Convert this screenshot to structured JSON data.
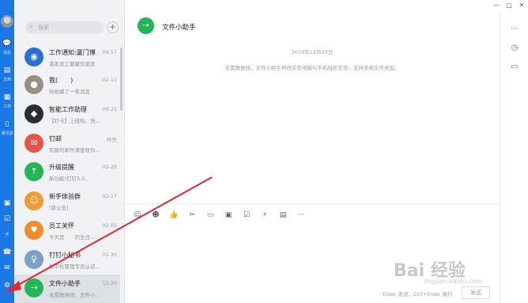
{
  "rail": {
    "labels": [
      "消息",
      "文档",
      "工作",
      "通讯录"
    ]
  },
  "search": {
    "placeholder": "搜索",
    "add": "+"
  },
  "conversations": [
    {
      "title": "工作通知:厦门博...",
      "time": "09:57",
      "preview": "诸发员工健康信息管",
      "color": "#2a6fd6",
      "icon": "◉"
    },
    {
      "title": "我(　　)",
      "time": "02-11",
      "preview": "你收藏了一条消息",
      "color": "#9a8f86",
      "icon": "●"
    },
    {
      "title": "智能工作助理",
      "time": "09:21",
      "preview": "【打卡】上班啦，快...",
      "color": "#2a2d33",
      "icon": "◆"
    },
    {
      "title": "钉邮",
      "time": "昨天",
      "preview": "有新的邮件请查收你...",
      "color": "#e8524a",
      "icon": "✉"
    },
    {
      "title": "升级提醒",
      "time": "02-26",
      "preview": "新功能!钉钉5.0...",
      "color": "#24b45a",
      "icon": "↑"
    },
    {
      "title": "新手体验群",
      "time": "02-17",
      "preview": "[新公告]",
      "color": "#f19a38",
      "icon": "☺"
    },
    {
      "title": "员工关怀",
      "time": "02-05",
      "preview": "今天是　　的生日...",
      "color": "#f28b2c",
      "icon": "♥"
    },
    {
      "title": "钉钉小秘书",
      "time": "01-30",
      "preview": "数字化管理专员认证...",
      "color": "#7aa0c8",
      "icon": "♀"
    },
    {
      "title": "文件小助手",
      "time": "12-20",
      "preview": "无需数据线，文件小...",
      "color": "#24b45a",
      "icon": "⇢"
    }
  ],
  "chat": {
    "title": "文件小助手",
    "date": "2019年12月20日",
    "notice": "无需数据线，文件小助手帮你实现电脑与手机轻松互传，支持多类文件类型。",
    "toolbar": [
      "☺",
      "☻",
      "👍",
      "✂",
      "▭",
      "▣",
      "☑",
      "⚡",
      "▤",
      "···"
    ],
    "hint": "Enter 发送，Ctrl+Enter 换行",
    "send_label": "发送"
  },
  "side_icons": [
    "⋯",
    "◷",
    "▭"
  ],
  "window_controls": [
    "—",
    "▢",
    "✕"
  ],
  "watermark": {
    "main": "Bai 经验",
    "sub": "jingyan.baidu.com"
  }
}
